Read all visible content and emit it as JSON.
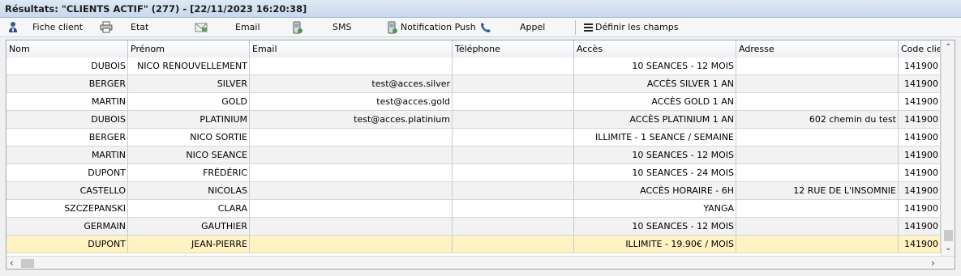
{
  "window": {
    "title": "Résultats: \"CLIENTS ACTIF\" (277) - [22/11/2023 16:20:38]"
  },
  "toolbar": {
    "fiche_client": "Fiche client",
    "etat": "Etat",
    "email": "Email",
    "sms": "SMS",
    "notification_push": "Notification Push",
    "appel": "Appel",
    "definir_champs": "Définir les champs"
  },
  "columns": [
    "Nom",
    "Prénom",
    "Email",
    "Téléphone",
    "Accès",
    "Adresse",
    "Code client"
  ],
  "rows": [
    {
      "nom": "DUBOIS",
      "prenom": "NICO RENOUVELLEMENT",
      "email": "",
      "telephone": "",
      "acces": "10 SEANCES - 12 MOIS",
      "adresse": "",
      "code": "141900"
    },
    {
      "nom": "BERGER",
      "prenom": "SILVER",
      "email": "test@acces.silver",
      "telephone": "",
      "acces": "ACCÈS SILVER 1 AN",
      "adresse": "",
      "code": "141900"
    },
    {
      "nom": "MARTIN",
      "prenom": "GOLD",
      "email": "test@acces.gold",
      "telephone": "",
      "acces": "ACCÈS GOLD 1 AN",
      "adresse": "",
      "code": "141900"
    },
    {
      "nom": "DUBOIS",
      "prenom": "PLATINIUM",
      "email": "test@acces.platinium",
      "telephone": "",
      "acces": "ACCÈS PLATINIUM 1 AN",
      "adresse": "602 chemin du test",
      "code": "141900"
    },
    {
      "nom": "BERGER",
      "prenom": "NICO SORTIE",
      "email": "",
      "telephone": "",
      "acces": "ILLIMITE - 1 SEANCE / SEMAINE",
      "adresse": "",
      "code": "141900"
    },
    {
      "nom": "MARTIN",
      "prenom": "NICO SEANCE",
      "email": "",
      "telephone": "",
      "acces": "10 SEANCES - 12 MOIS",
      "adresse": "",
      "code": "141900"
    },
    {
      "nom": "DUPONT",
      "prenom": "FRÉDÉRIC",
      "email": "",
      "telephone": "",
      "acces": "10 SEANCES - 24 MOIS",
      "adresse": "",
      "code": "141900"
    },
    {
      "nom": "CASTELLO",
      "prenom": "NICOLAS",
      "email": "",
      "telephone": "",
      "acces": "ACCÈS HORAIRE - 6H",
      "adresse": "12 RUE DE L'INSOMNIE",
      "code": "141900"
    },
    {
      "nom": "SZCZEPANSKI",
      "prenom": "CLARA",
      "email": "",
      "telephone": "",
      "acces": "YANGA",
      "adresse": "",
      "code": "141900"
    },
    {
      "nom": "GERMAIN",
      "prenom": "GAUTHIER",
      "email": "",
      "telephone": "",
      "acces": "10 SEANCES - 12 MOIS",
      "adresse": "",
      "code": "141900"
    },
    {
      "nom": "DUPONT",
      "prenom": "JEAN-PIERRE",
      "email": "",
      "telephone": "",
      "acces": "ILLIMITE - 19.90€ / MOIS",
      "adresse": "",
      "code": "141900"
    }
  ],
  "selected_row": 10,
  "colors": {
    "selected_row": "#fff3c2",
    "alt_row": "#f2f2f2",
    "header_bg": "#c8d8ec"
  },
  "icons": [
    "person-icon",
    "printer-icon",
    "email-icon",
    "phone-sms-icon",
    "phone-icon",
    "menu-icon"
  ]
}
